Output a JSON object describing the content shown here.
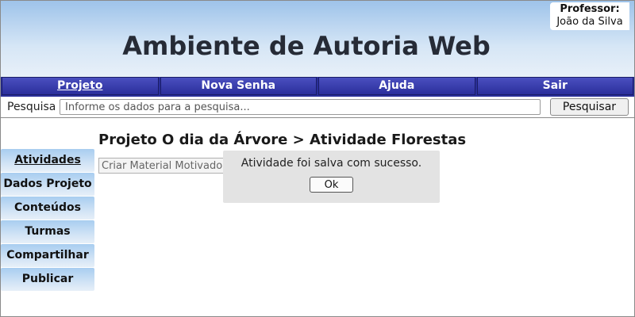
{
  "header": {
    "title": "Ambiente de Autoria Web",
    "professor_label": "Professor:",
    "professor_name": "João da Silva"
  },
  "nav": {
    "items": [
      {
        "label": "Projeto",
        "active": true
      },
      {
        "label": "Nova Senha"
      },
      {
        "label": "Ajuda"
      },
      {
        "label": "Sair"
      }
    ]
  },
  "search": {
    "label": "Pesquisa",
    "placeholder": "Informe os dados para a pesquisa...",
    "value": "",
    "button_label": "Pesquisar"
  },
  "sidebar": {
    "items": [
      {
        "label": "Atividades",
        "active": true
      },
      {
        "label": "Dados Projeto"
      },
      {
        "label": "Conteúdos"
      },
      {
        "label": "Turmas"
      },
      {
        "label": "Compartilhar"
      },
      {
        "label": "Publicar"
      }
    ]
  },
  "main": {
    "breadcrumb": "Projeto O dia da Árvore > Atividade Florestas",
    "material_input_value": "Criar Material Motivador"
  },
  "modal": {
    "message": "Atividade foi salva com sucesso.",
    "ok_label": "Ok"
  }
}
